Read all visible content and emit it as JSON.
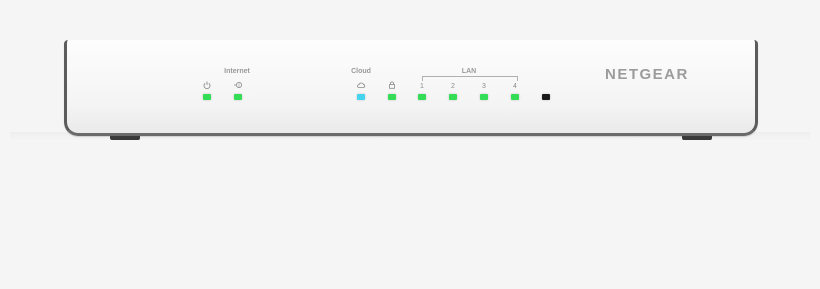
{
  "device": {
    "brand": "NETGEAR",
    "labels": {
      "internet": "Internet",
      "cloud": "Cloud",
      "lan": "LAN"
    },
    "lan_ports": [
      "1",
      "2",
      "3",
      "4"
    ],
    "icons": {
      "power": "power-icon",
      "internet": "internet-globe-icon",
      "cloud": "cloud-icon",
      "security": "lock-icon"
    },
    "led_colors": {
      "green": "#33dd55",
      "cyan": "#44d4f0",
      "off": "#1a1a1a"
    }
  }
}
